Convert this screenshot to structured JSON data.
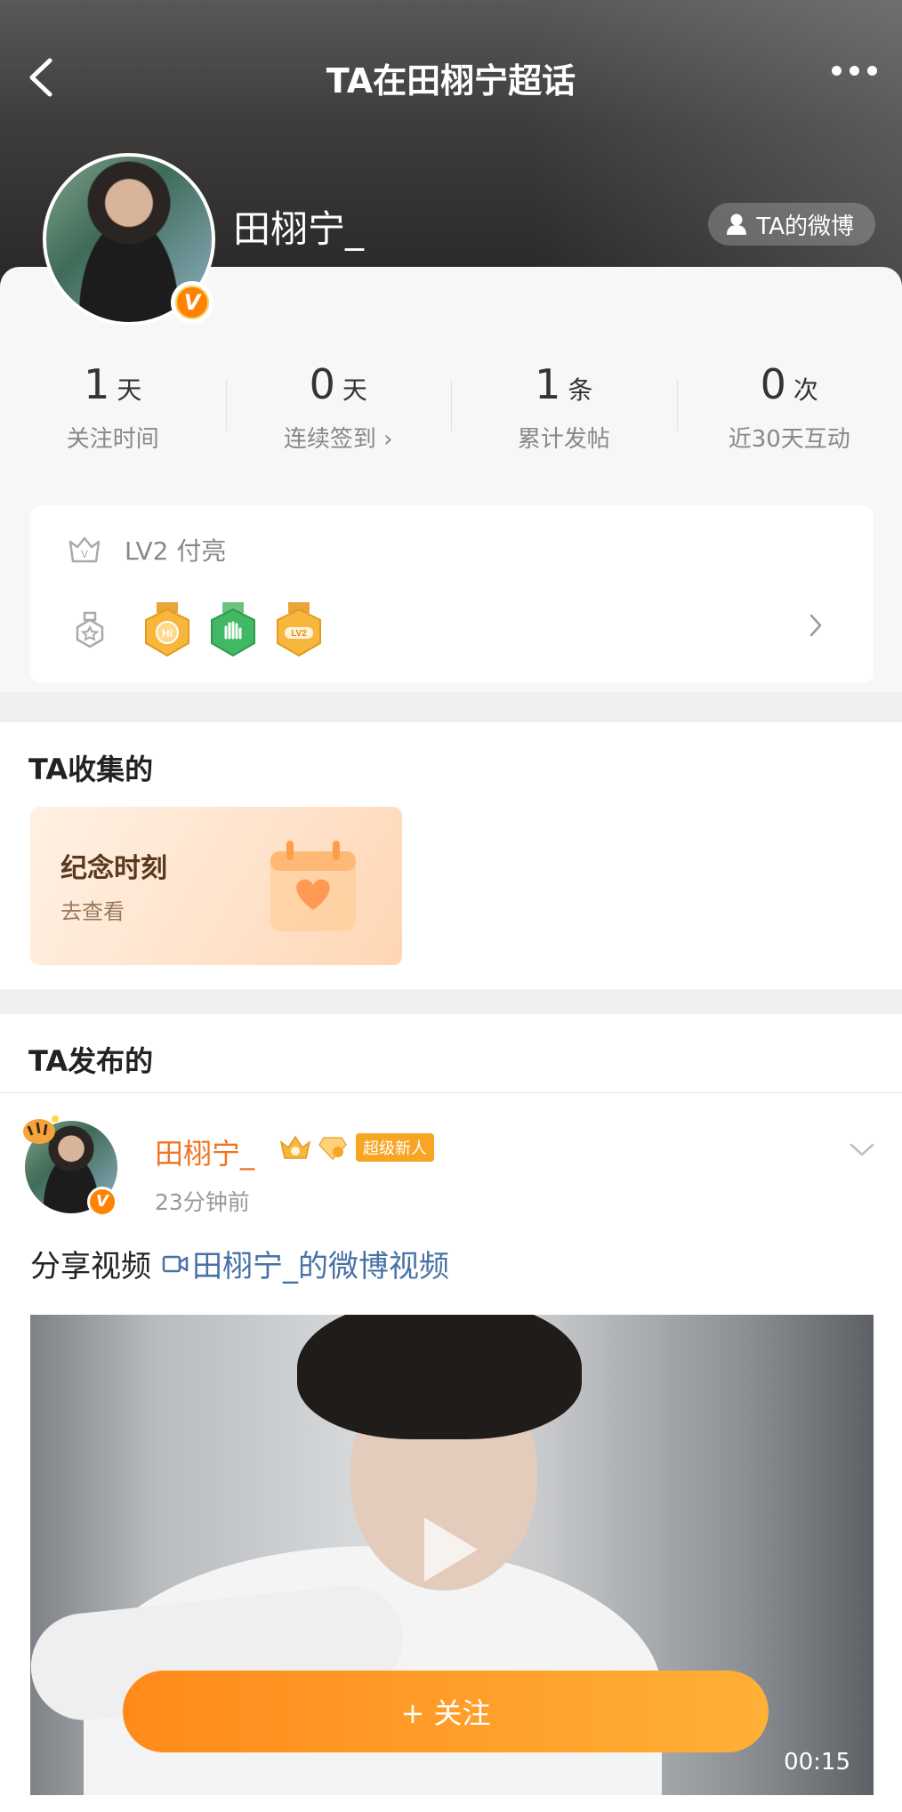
{
  "nav": {
    "title": "TA在田栩宁超话"
  },
  "profile": {
    "username": "田栩宁_",
    "weibo_button": "TA的微博",
    "verified_badge": "V"
  },
  "stats": [
    {
      "number": "1",
      "unit": "天",
      "label": "关注时间"
    },
    {
      "number": "0",
      "unit": "天",
      "label": "连续签到 ›"
    },
    {
      "number": "1",
      "unit": "条",
      "label": "累计发帖"
    },
    {
      "number": "0",
      "unit": "次",
      "label": "近30天互动"
    }
  ],
  "level": {
    "text": "LV2 付亮",
    "medals": [
      "Hi",
      "hand",
      "LV2"
    ]
  },
  "collected": {
    "title": "TA收集的",
    "card_title": "纪念时刻",
    "card_sub": "去查看"
  },
  "published": {
    "title": "TA发布的"
  },
  "post": {
    "name": "田栩宁_",
    "newbie_badge": "超级新人",
    "time": "23分钟前",
    "text": "分享视频",
    "video_link": "田栩宁_的微博视频",
    "duration": "00:15"
  },
  "follow_button": "+ 关注",
  "colors": {
    "accent_orange": "#ff8200",
    "link_blue": "#4872a6",
    "name_orange": "#f27320"
  }
}
